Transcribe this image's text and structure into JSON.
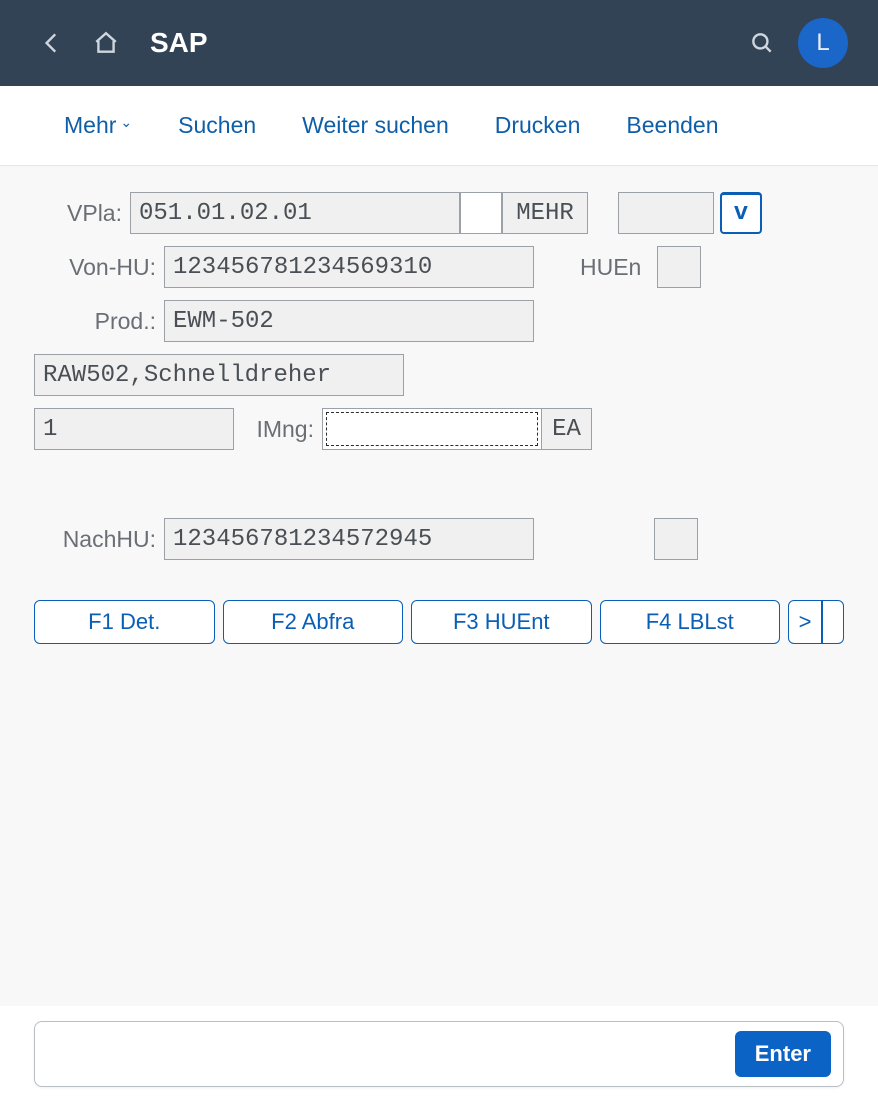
{
  "header": {
    "title": "SAP",
    "avatar_initial": "L"
  },
  "toolbar": {
    "mehr": "Mehr",
    "suchen": "Suchen",
    "weiter_suchen": "Weiter suchen",
    "drucken": "Drucken",
    "beenden": "Beenden"
  },
  "fields": {
    "vpla_label": "VPla:",
    "vpla_value": "051.01.02.01",
    "mehr_tag": "MEHR",
    "v_btn": "v",
    "vonhu_label": "Von-HU:",
    "vonhu_value": "123456781234569310",
    "huen_label": "HUEn",
    "prod_label": "Prod.:",
    "prod_value": "EWM-502",
    "desc_value": "RAW502,Schnelldreher",
    "qty_value": "1",
    "imng_label": "IMng:",
    "imng_value": "",
    "uom_value": "EA",
    "nachhu_label": "NachHU:",
    "nachhu_value": "123456781234572945"
  },
  "fkeys": {
    "f1": "F1 Det.",
    "f2": "F2 Abfra",
    "f3": "F3 HUEnt",
    "f4": "F4 LBLst",
    "more": ">"
  },
  "footer": {
    "enter": "Enter"
  }
}
